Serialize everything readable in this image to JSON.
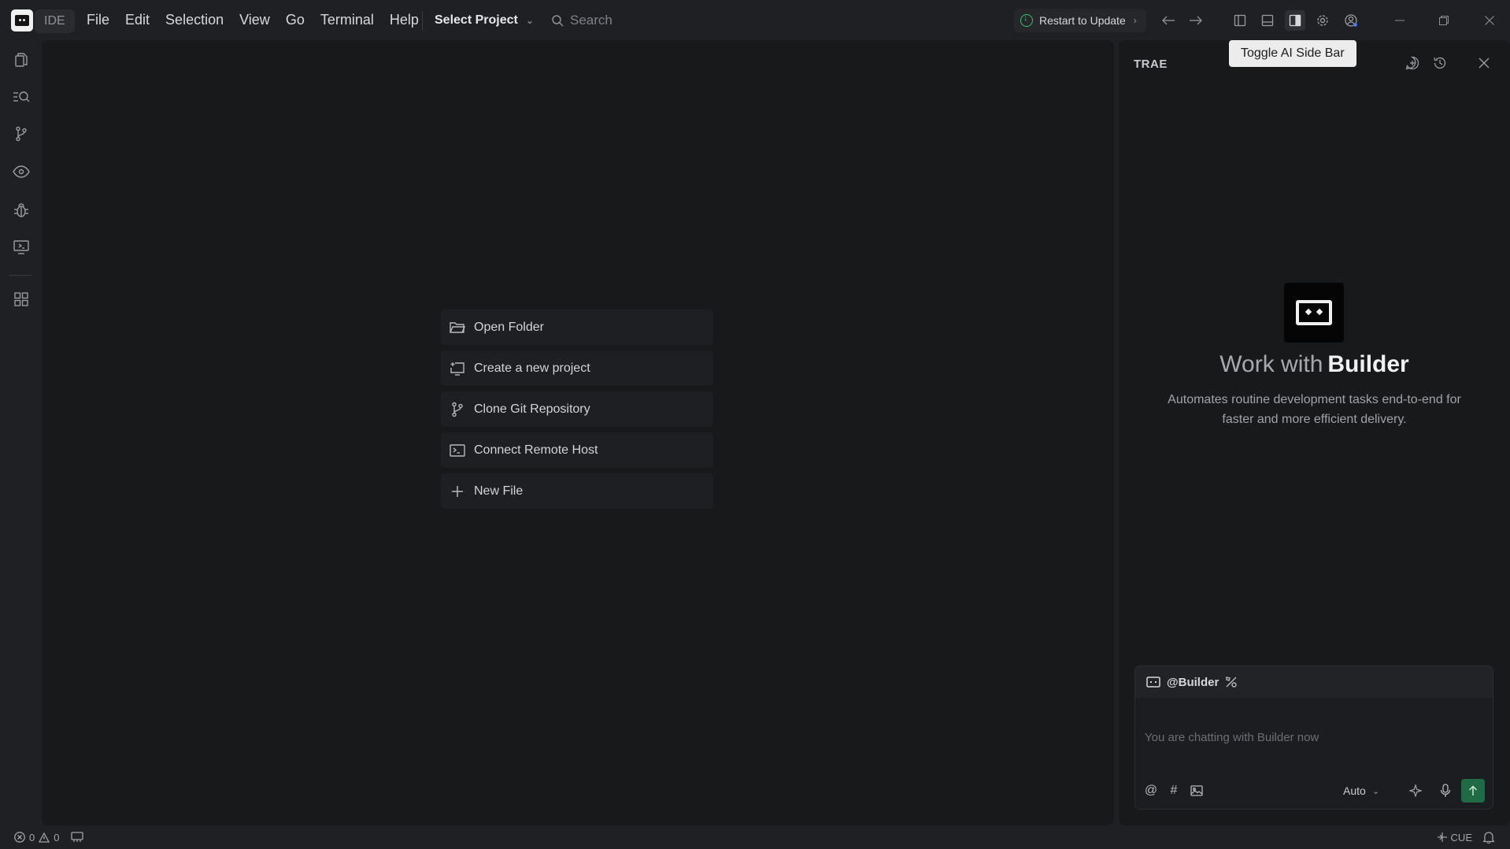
{
  "titlebar": {
    "app_badge": "IDE",
    "menu": [
      "File",
      "Edit",
      "Selection",
      "View",
      "Go",
      "Terminal",
      "Help"
    ],
    "project_select": "Select Project",
    "search_placeholder": "Search",
    "restart_label": "Restart to Update"
  },
  "tooltip": "Toggle AI Side Bar",
  "start": {
    "items": [
      {
        "label": "Open Folder",
        "icon": "folder-open-icon"
      },
      {
        "label": "Create a new project",
        "icon": "new-project-icon"
      },
      {
        "label": "Clone Git Repository",
        "icon": "git-branch-icon"
      },
      {
        "label": "Connect Remote Host",
        "icon": "remote-host-icon"
      },
      {
        "label": "New File",
        "icon": "plus-icon"
      }
    ]
  },
  "ai": {
    "title": "TRAE",
    "work_prefix": "Work with",
    "work_name": "Builder",
    "description": "Automates routine development tasks end-to-end for faster and more efficient delivery.",
    "mention": "@Builder",
    "input_placeholder": "You are chatting with Builder now",
    "mode": "Auto"
  },
  "status": {
    "errors": "0",
    "warnings": "0",
    "language": "CUE"
  },
  "colors": {
    "send_button": "#1f6b45",
    "update_indicator": "#3fbf6b"
  }
}
